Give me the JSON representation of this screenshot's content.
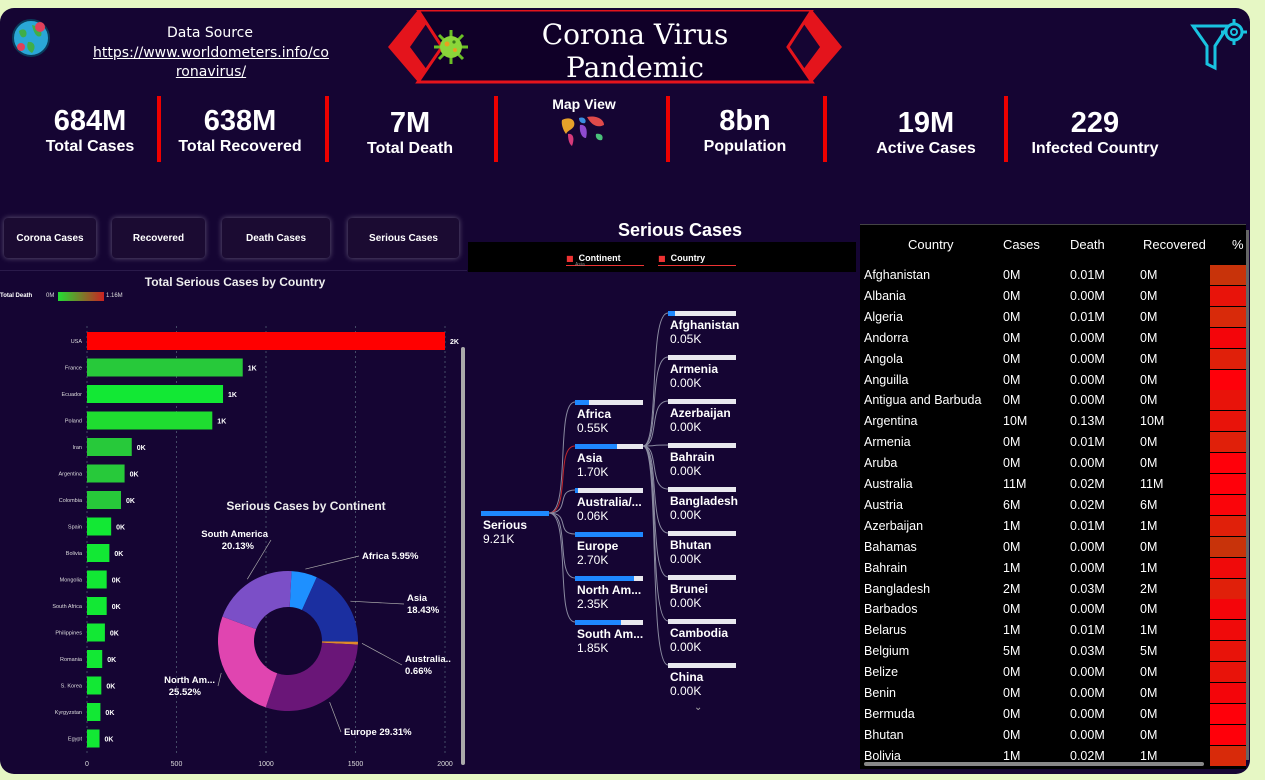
{
  "header": {
    "source_title": "Data  Source",
    "source_link": "https://www.worldometers.info/coronavirus/",
    "title": "Corona Virus Pandemic",
    "map_view": "Map View"
  },
  "kpis": [
    {
      "value": "684M",
      "label": "Total Cases"
    },
    {
      "value": "638M",
      "label": "Total Recovered"
    },
    {
      "value": "7M",
      "label": "Total Death"
    },
    {
      "value": "8bn",
      "label": "Population"
    },
    {
      "value": "19M",
      "label": "Active Cases"
    },
    {
      "value": "229",
      "label": "Infected Country"
    }
  ],
  "buttons": [
    "Corona Cases",
    "Recovered",
    "Death Cases",
    "Serious Cases"
  ],
  "colors": {
    "background": "#150533",
    "accent_red": "#ee0000",
    "bar_green": "#22cc33",
    "bar_red": "#ff0000",
    "tree_blue": "#1e88ff"
  },
  "chart_data": [
    {
      "type": "bar",
      "title": "Total Serious Cases by Country",
      "legend": {
        "label": "Total Death",
        "min": "0M",
        "max": "1.16M"
      },
      "categories": [
        "USA",
        "France",
        "Ecuador",
        "Poland",
        "Iran",
        "Argentina",
        "Colombia",
        "Spain",
        "Bolivia",
        "Mongolia",
        "South Africa",
        "Philippines",
        "Romania",
        "S. Korea",
        "Kyrgyzstan",
        "Egypt"
      ],
      "values": [
        2000,
        870,
        760,
        700,
        250,
        210,
        190,
        135,
        125,
        110,
        110,
        100,
        85,
        80,
        75,
        70
      ],
      "data_labels": [
        "2K",
        "1K",
        "1K",
        "1K",
        "0K",
        "0K",
        "0K",
        "0K",
        "0K",
        "0K",
        "0K",
        "0K",
        "0K",
        "0K",
        "0K",
        "0K"
      ],
      "bar_colors": [
        "#ff0000",
        "#27c93a",
        "#12e834",
        "#1fdc30",
        "#27c93a",
        "#27c93a",
        "#27c93a",
        "#12e834",
        "#12e834",
        "#12e834",
        "#12e834",
        "#12e834",
        "#12e834",
        "#12e834",
        "#12e834",
        "#12e834"
      ],
      "xticks": [
        "0",
        "500",
        "1000",
        "1500",
        "2000"
      ],
      "xlim": [
        0,
        2000
      ]
    },
    {
      "type": "pie",
      "title": "Serious Cases by Continent",
      "slices": [
        {
          "name": "Africa",
          "value": 5.95,
          "label": "Africa 5.95%",
          "color": "#1e90ff"
        },
        {
          "name": "Asia",
          "value": 18.43,
          "label": "Asia 18.43%",
          "color": "#1b2fa0"
        },
        {
          "name": "Australia..",
          "value": 0.66,
          "label": "Australia.. 0.66%",
          "color": "#e08a2a"
        },
        {
          "name": "Europe",
          "value": 29.31,
          "label": "Europe 29.31%",
          "color": "#6a1678"
        },
        {
          "name": "North Am...",
          "value": 25.52,
          "label": "North Am... 25.52%",
          "color": "#e045b0"
        },
        {
          "name": "South America",
          "value": 20.13,
          "label": "South America 20.13%",
          "color": "#7b4fc7"
        }
      ]
    }
  ],
  "tree": {
    "title": "Serious Cases",
    "filters": [
      "Continent",
      "Country"
    ],
    "filter_sub": "Asia",
    "root": {
      "label": "Serious",
      "value": "9.21K"
    },
    "continents": [
      {
        "label": "Africa",
        "value": "0.55K",
        "fill": 0.2
      },
      {
        "label": "Asia",
        "value": "1.70K",
        "fill": 0.62
      },
      {
        "label": "Australia/...",
        "value": "0.06K",
        "fill": 0.05
      },
      {
        "label": "Europe",
        "value": "2.70K",
        "fill": 1.0
      },
      {
        "label": "North Am...",
        "value": "2.35K",
        "fill": 0.87
      },
      {
        "label": "South Am...",
        "value": "1.85K",
        "fill": 0.68
      }
    ],
    "countries": [
      {
        "label": "Afghanistan",
        "value": "0.05K",
        "fill": 0.1
      },
      {
        "label": "Armenia",
        "value": "0.00K",
        "fill": 0.0
      },
      {
        "label": "Azerbaijan",
        "value": "0.00K",
        "fill": 0.0
      },
      {
        "label": "Bahrain",
        "value": "0.00K",
        "fill": 0.0
      },
      {
        "label": "Bangladesh",
        "value": "0.00K",
        "fill": 0.0
      },
      {
        "label": "Bhutan",
        "value": "0.00K",
        "fill": 0.0
      },
      {
        "label": "Brunei",
        "value": "0.00K",
        "fill": 0.0
      },
      {
        "label": "Cambodia",
        "value": "0.00K",
        "fill": 0.0
      },
      {
        "label": "China",
        "value": "0.00K",
        "fill": 0.0
      }
    ]
  },
  "table": {
    "headers": [
      "Country",
      "Cases",
      "Death",
      "Recovered",
      "%"
    ],
    "rows": [
      [
        "Afghanistan",
        "0M",
        "0.01M",
        "0M",
        "#c8330a"
      ],
      [
        "Albania",
        "0M",
        "0.00M",
        "0M",
        "#e8130a"
      ],
      [
        "Algeria",
        "0M",
        "0.01M",
        "0M",
        "#d82a0a"
      ],
      [
        "Andorra",
        "0M",
        "0.00M",
        "0M",
        "#f4050a"
      ],
      [
        "Angola",
        "0M",
        "0.00M",
        "0M",
        "#e0200a"
      ],
      [
        "Anguilla",
        "0M",
        "0.00M",
        "0M",
        "#ff000a"
      ],
      [
        "Antigua and Barbuda",
        "0M",
        "0.00M",
        "0M",
        "#e8130a"
      ],
      [
        "Argentina",
        "10M",
        "0.13M",
        "10M",
        "#e8130a"
      ],
      [
        "Armenia",
        "0M",
        "0.01M",
        "0M",
        "#e0200a"
      ],
      [
        "Aruba",
        "0M",
        "0.00M",
        "0M",
        "#ff000a"
      ],
      [
        "Australia",
        "11M",
        "0.02M",
        "11M",
        "#ff000a"
      ],
      [
        "Austria",
        "6M",
        "0.02M",
        "6M",
        "#fa050a"
      ],
      [
        "Azerbaijan",
        "1M",
        "0.01M",
        "1M",
        "#e0200a"
      ],
      [
        "Bahamas",
        "0M",
        "0.00M",
        "0M",
        "#c8330a"
      ],
      [
        "Bahrain",
        "1M",
        "0.00M",
        "1M",
        "#f00a0a"
      ],
      [
        "Bangladesh",
        "2M",
        "0.03M",
        "2M",
        "#e0200a"
      ],
      [
        "Barbados",
        "0M",
        "0.00M",
        "0M",
        "#f4050a"
      ],
      [
        "Belarus",
        "1M",
        "0.01M",
        "1M",
        "#f00a0a"
      ],
      [
        "Belgium",
        "5M",
        "0.03M",
        "5M",
        "#e8130a"
      ],
      [
        "Belize",
        "0M",
        "0.00M",
        "0M",
        "#e8130a"
      ],
      [
        "Benin",
        "0M",
        "0.00M",
        "0M",
        "#f4050a"
      ],
      [
        "Bermuda",
        "0M",
        "0.00M",
        "0M",
        "#ff000a"
      ],
      [
        "Bhutan",
        "0M",
        "0.00M",
        "0M",
        "#ff000a"
      ],
      [
        "Bolivia",
        "1M",
        "0.02M",
        "1M",
        "#d82a0a"
      ]
    ]
  }
}
